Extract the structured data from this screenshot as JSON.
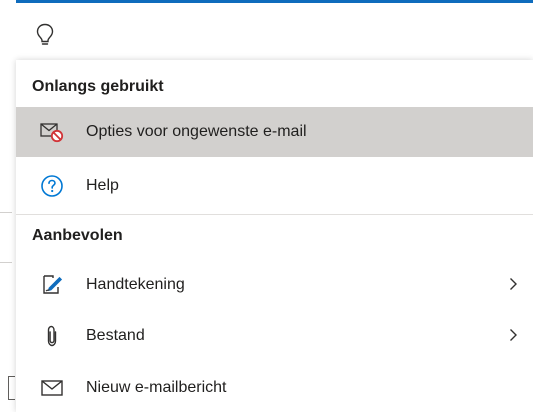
{
  "search": {
    "icon": "lightbulb-icon"
  },
  "menu": {
    "recent_title": "Onlangs gebruikt",
    "recent_items": [
      {
        "label": "Opties voor ongewenste e-mail",
        "icon": "junk-mail-options-icon",
        "selected": true
      },
      {
        "label": "Help",
        "icon": "help-icon",
        "selected": false
      }
    ],
    "recommended_title": "Aanbevolen",
    "recommended_items": [
      {
        "label": "Handtekening",
        "icon": "signature-icon",
        "has_submenu": true
      },
      {
        "label": "Bestand",
        "icon": "paperclip-icon",
        "has_submenu": true
      },
      {
        "label": "Nieuw e-mailbericht",
        "icon": "envelope-icon",
        "has_submenu": false
      }
    ]
  },
  "colors": {
    "accent": "#0f6cbd",
    "selected_bg": "#d2d0ce",
    "help_blue": "#0078d4",
    "block_red": "#d13438"
  }
}
